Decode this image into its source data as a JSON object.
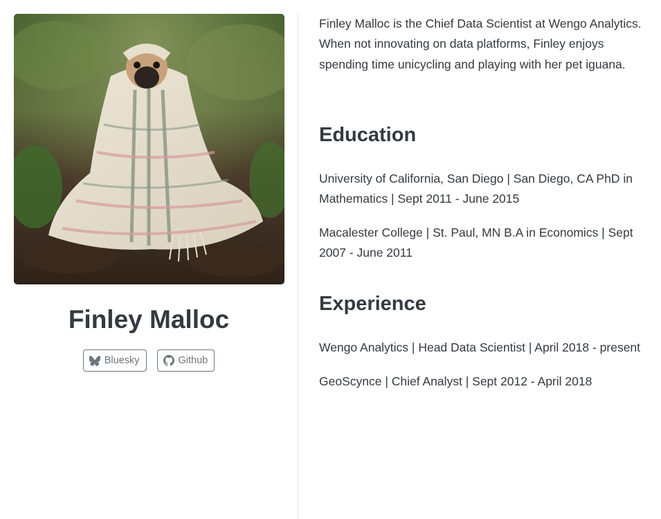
{
  "profile": {
    "name": "Finley Malloc",
    "links": [
      {
        "label": "Bluesky",
        "icon": "bluesky-butterfly-icon"
      },
      {
        "label": "Github",
        "icon": "github-icon"
      }
    ]
  },
  "about": {
    "bio": "Finley Malloc is the Chief Data Scientist at Wengo Analytics. When not innovating on data platforms, Finley enjoys spending time unicycling and playing with her pet iguana."
  },
  "education": {
    "heading": "Education",
    "items": [
      "University of California, San Diego | San Diego, CA PhD in Mathematics | Sept 2011 - June 2015",
      "Macalester College | St. Paul, MN B.A in Economics | Sept 2007 - June 2011"
    ]
  },
  "experience": {
    "heading": "Experience",
    "items": [
      "Wengo Analytics | Head Data Scientist | April 2018 - present",
      "GeoScynce | Chief Analyst | Sept 2012 - April 2018"
    ]
  },
  "colors": {
    "text": "#343a40",
    "muted": "#6c757d",
    "divider": "#dee2e6"
  }
}
